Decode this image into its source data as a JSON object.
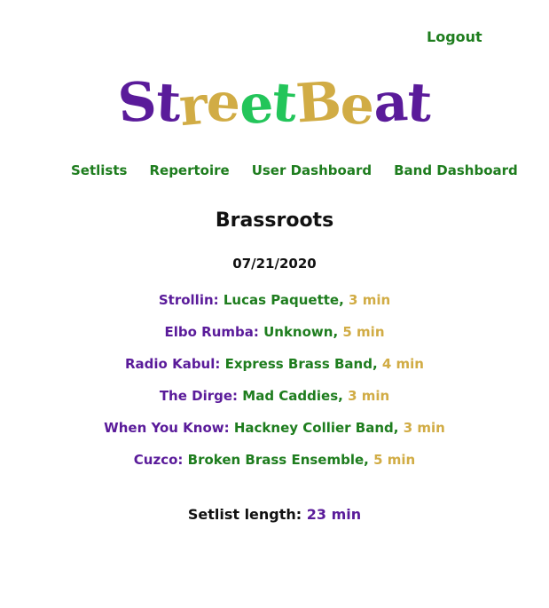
{
  "header": {
    "logout_label": "Logout"
  },
  "logo": {
    "text": "StreetBeat",
    "letters": [
      {
        "char": "S",
        "color": "#5a1b9a"
      },
      {
        "char": "t",
        "color": "#5a1b9a"
      },
      {
        "char": "r",
        "color": "#d1ac45"
      },
      {
        "char": "e",
        "color": "#d1ac45"
      },
      {
        "char": "e",
        "color": "#23c55a"
      },
      {
        "char": "t",
        "color": "#23c55a"
      },
      {
        "char": "B",
        "color": "#d1ac45"
      },
      {
        "char": "e",
        "color": "#d1ac45"
      },
      {
        "char": "a",
        "color": "#5a1b9a"
      },
      {
        "char": "t",
        "color": "#5a1b9a"
      }
    ]
  },
  "nav": {
    "items": [
      {
        "label": "Setlists"
      },
      {
        "label": "Repertoire"
      },
      {
        "label": "User Dashboard"
      },
      {
        "label": "Band Dashboard"
      }
    ]
  },
  "setlist": {
    "band_name": "Brassroots",
    "date": "07/21/2020",
    "songs": [
      {
        "title": "Strollin:",
        "artist": "Lucas Paquette",
        "duration": "3 min"
      },
      {
        "title": "Elbo Rumba:",
        "artist": "Unknown",
        "duration": "5 min"
      },
      {
        "title": "Radio Kabul:",
        "artist": "Express Brass Band",
        "duration": "4 min"
      },
      {
        "title": "The Dirge:",
        "artist": "Mad Caddies",
        "duration": "3 min"
      },
      {
        "title": "When You Know:",
        "artist": "Hackney Collier Band",
        "duration": "3 min"
      },
      {
        "title": "Cuzco:",
        "artist": "Broken Brass Ensemble",
        "duration": "5 min"
      }
    ],
    "length_label": "Setlist length:",
    "length_value": "23 min"
  },
  "colors": {
    "purple": "#5a1b9a",
    "green": "#1e7d1e",
    "gold": "#d1ac45",
    "bright_green": "#23c55a"
  }
}
